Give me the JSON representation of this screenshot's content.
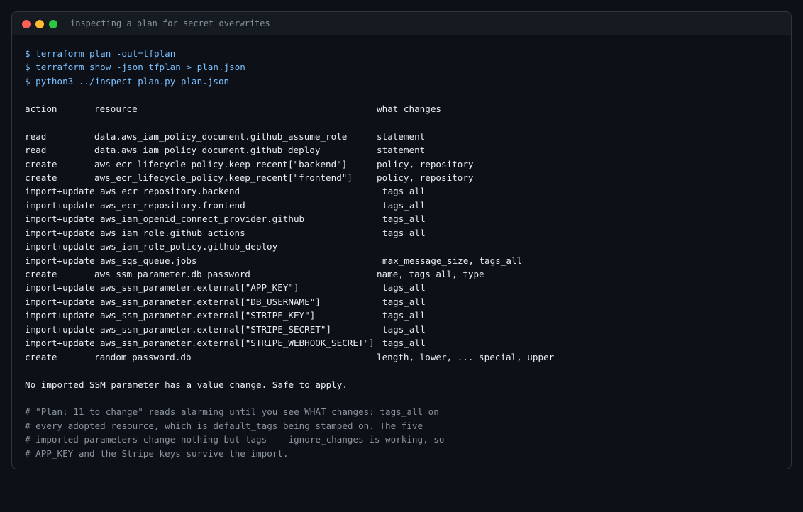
{
  "window": {
    "title": "inspecting a plan for secret overwrites",
    "dots": {
      "close_color": "#ff5f57",
      "minimize_color": "#febc2e",
      "zoom_color": "#28c840"
    }
  },
  "commands": [
    "$ terraform plan -out=tfplan",
    "$ terraform show -json tfplan > plan.json",
    "$ python3 ../inspect-plan.py plan.json"
  ],
  "table": {
    "headers": {
      "action": "action",
      "resource": "resource",
      "changes": "what changes"
    },
    "rule": "-------------------------------------------------------------------------------------------------",
    "rows": [
      {
        "action": "read",
        "resource": "data.aws_iam_policy_document.github_assume_role",
        "changes": "statement"
      },
      {
        "action": "read",
        "resource": "data.aws_iam_policy_document.github_deploy",
        "changes": "statement"
      },
      {
        "action": "create",
        "resource": "aws_ecr_lifecycle_policy.keep_recent[\"backend\"]",
        "changes": "policy, repository"
      },
      {
        "action": "create",
        "resource": "aws_ecr_lifecycle_policy.keep_recent[\"frontend\"]",
        "changes": "policy, repository"
      },
      {
        "action": "import+update",
        "resource": "aws_ecr_repository.backend",
        "changes": "tags_all"
      },
      {
        "action": "import+update",
        "resource": "aws_ecr_repository.frontend",
        "changes": "tags_all"
      },
      {
        "action": "import+update",
        "resource": "aws_iam_openid_connect_provider.github",
        "changes": "tags_all"
      },
      {
        "action": "import+update",
        "resource": "aws_iam_role.github_actions",
        "changes": "tags_all"
      },
      {
        "action": "import+update",
        "resource": "aws_iam_role_policy.github_deploy",
        "changes": "-"
      },
      {
        "action": "import+update",
        "resource": "aws_sqs_queue.jobs",
        "changes": "max_message_size, tags_all"
      },
      {
        "action": "create",
        "resource": "aws_ssm_parameter.db_password",
        "changes": "name, tags_all, type"
      },
      {
        "action": "import+update",
        "resource": "aws_ssm_parameter.external[\"APP_KEY\"]",
        "changes": "tags_all"
      },
      {
        "action": "import+update",
        "resource": "aws_ssm_parameter.external[\"DB_USERNAME\"]",
        "changes": "tags_all"
      },
      {
        "action": "import+update",
        "resource": "aws_ssm_parameter.external[\"STRIPE_KEY\"]",
        "changes": "tags_all"
      },
      {
        "action": "import+update",
        "resource": "aws_ssm_parameter.external[\"STRIPE_SECRET\"]",
        "changes": "tags_all"
      },
      {
        "action": "import+update",
        "resource": "aws_ssm_parameter.external[\"STRIPE_WEBHOOK_SECRET\"]",
        "changes": "tags_all"
      },
      {
        "action": "create",
        "resource": "random_password.db",
        "changes": "length, lower, ... special, upper"
      }
    ]
  },
  "summary": "No imported SSM parameter has a value change. Safe to apply.",
  "comments": [
    "# \"Plan: 11 to change\" reads alarming until you see WHAT changes: tags_all on",
    "# every adopted resource, which is default_tags being stamped on. The five",
    "# imported parameters change nothing but tags -- ignore_changes is working, so",
    "# APP_KEY and the Stripe keys survive the import."
  ]
}
